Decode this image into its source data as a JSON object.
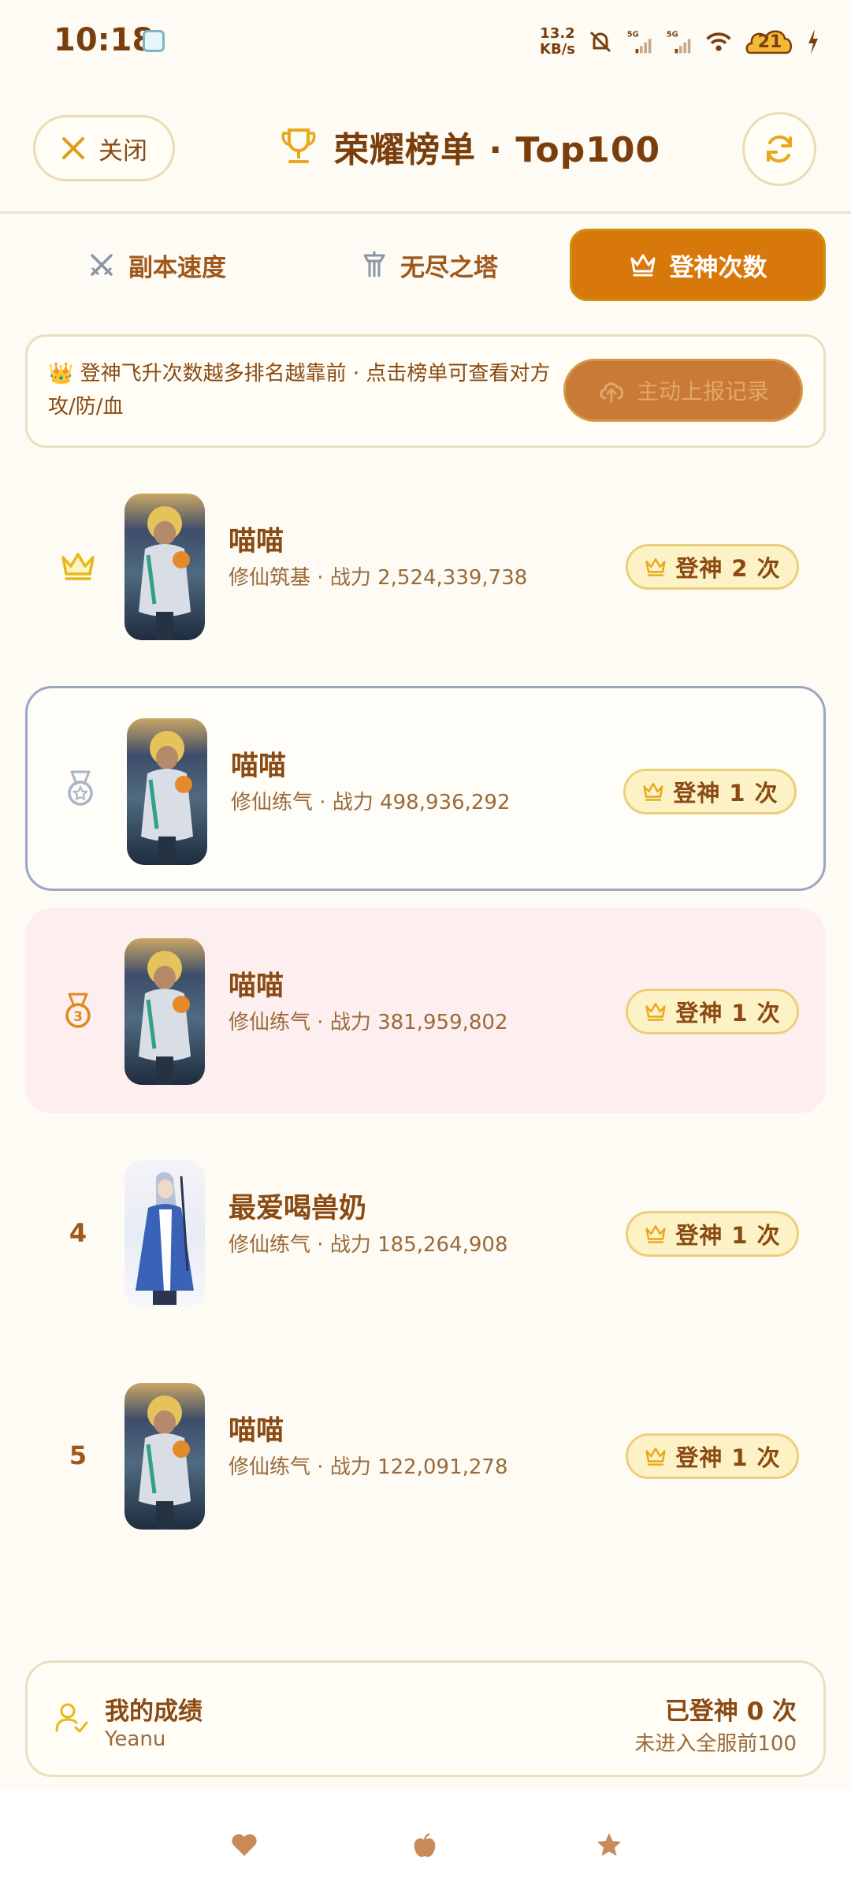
{
  "status_bar": {
    "time": "10:18",
    "speed_value": "13.2",
    "speed_unit": "KB/s",
    "net1": "5G",
    "net2": "5G",
    "battery": "21"
  },
  "header": {
    "close_label": "关闭",
    "title": "荣耀榜单 · Top100"
  },
  "tabs": [
    {
      "label": "副本速度",
      "icon": "swords-icon",
      "active": false
    },
    {
      "label": "无尽之塔",
      "icon": "tower-icon",
      "active": false
    },
    {
      "label": "登神次数",
      "icon": "crown-icon",
      "active": true
    }
  ],
  "info": {
    "text": "👑 登神飞升次数越多排名越靠前 · 点击榜单可查看对方攻/防/血",
    "upload_label": "主动上报记录"
  },
  "rows": [
    {
      "rank": "1",
      "rank_icon": "crown-icon",
      "name": "喵喵",
      "realm": "修仙筑基",
      "power_label": "战力",
      "power": "2,524,339,738",
      "badge": "登神 2 次"
    },
    {
      "rank": "2",
      "rank_icon": "silver-medal-icon",
      "name": "喵喵",
      "realm": "修仙练气",
      "power_label": "战力",
      "power": "498,936,292",
      "badge": "登神 1 次"
    },
    {
      "rank": "3",
      "rank_icon": "bronze-medal-icon",
      "name": "喵喵",
      "realm": "修仙练气",
      "power_label": "战力",
      "power": "381,959,802",
      "badge": "登神 1 次"
    },
    {
      "rank": "4",
      "rank_icon": "",
      "name": "最爱喝兽奶",
      "realm": "修仙练气",
      "power_label": "战力",
      "power": "185,264,908",
      "badge": "登神 1 次"
    },
    {
      "rank": "5",
      "rank_icon": "",
      "name": "喵喵",
      "realm": "修仙练气",
      "power_label": "战力",
      "power": "122,091,278",
      "badge": "登神 1 次"
    }
  ],
  "mine": {
    "title": "我的成绩",
    "user": "Yeanu",
    "count": "已登神 0 次",
    "note": "未进入全服前100"
  },
  "colors": {
    "accent": "#d9780a",
    "gold": "#e8b81a",
    "background": "#fdfbf4"
  }
}
